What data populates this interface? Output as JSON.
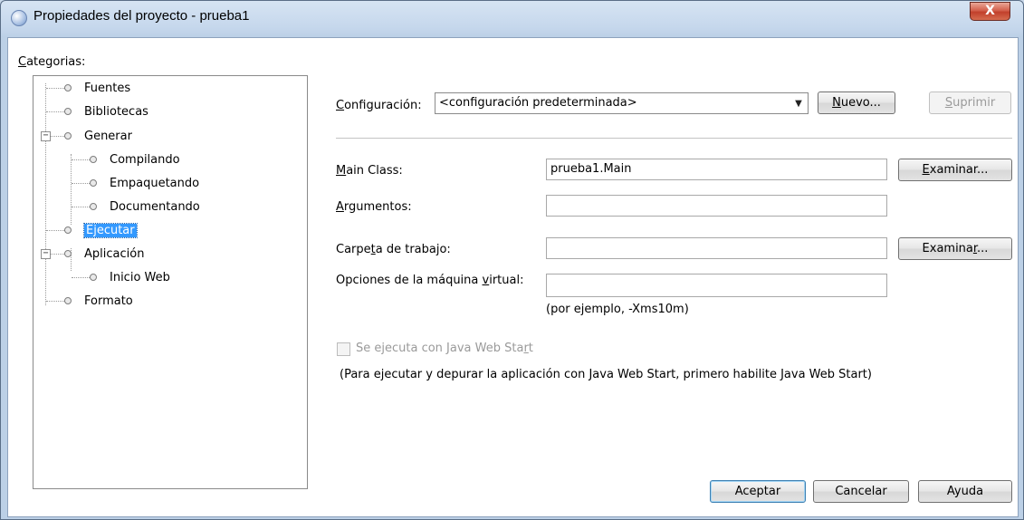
{
  "window": {
    "title": "Propiedades del proyecto - prueba1",
    "close_label": "X"
  },
  "categories": {
    "label_accel": "C",
    "label_rest": "ategorias:",
    "items": [
      {
        "label": "Fuentes",
        "selected": false
      },
      {
        "label": "Bibliotecas",
        "selected": false
      },
      {
        "label": "Generar",
        "selected": false,
        "expanded": true
      },
      {
        "label": "Compilando",
        "selected": false
      },
      {
        "label": "Empaquetando",
        "selected": false
      },
      {
        "label": "Documentando",
        "selected": false
      },
      {
        "label": "Ejecutar",
        "selected": true
      },
      {
        "label": "Aplicación",
        "selected": false,
        "expanded": true
      },
      {
        "label": "Inicio Web",
        "selected": false
      },
      {
        "label": "Formato",
        "selected": false
      }
    ]
  },
  "configuration": {
    "label_accel": "C",
    "label_rest": "onfiguración:",
    "value": "<configuración predeterminada>",
    "new_accel": "N",
    "new_rest": "uevo...",
    "delete_accel": "S",
    "delete_rest": "uprimir"
  },
  "form": {
    "main_class": {
      "label_accel": "M",
      "label_rest": "ain Class:",
      "value": "prueba1.Main",
      "browse_accel": "E",
      "browse_rest": "xaminar..."
    },
    "arguments": {
      "label_accel": "A",
      "label_rest": "rgumentos:",
      "value": ""
    },
    "working_dir": {
      "label_pre": "Carpe",
      "label_accel": "t",
      "label_rest": "a de trabajo:",
      "value": "",
      "browse_pre": "Examina",
      "browse_accel": "r",
      "browse_rest": "..."
    },
    "vm_options": {
      "label_pre": "Opciones de la máquina ",
      "label_accel": "v",
      "label_rest": "irtual:",
      "value": "",
      "hint": "(por ejemplo, -Xms10m)"
    },
    "web_start": {
      "label_pre": "Se ejecuta con Java Web Sta",
      "label_accel": "r",
      "label_rest": "t",
      "checked": false,
      "note": "(Para ejecutar y depurar la aplicación con Java Web Start, primero habilite Java Web Start)"
    }
  },
  "footer": {
    "accept": "Aceptar",
    "cancel": "Cancelar",
    "help": "Ayuda"
  }
}
